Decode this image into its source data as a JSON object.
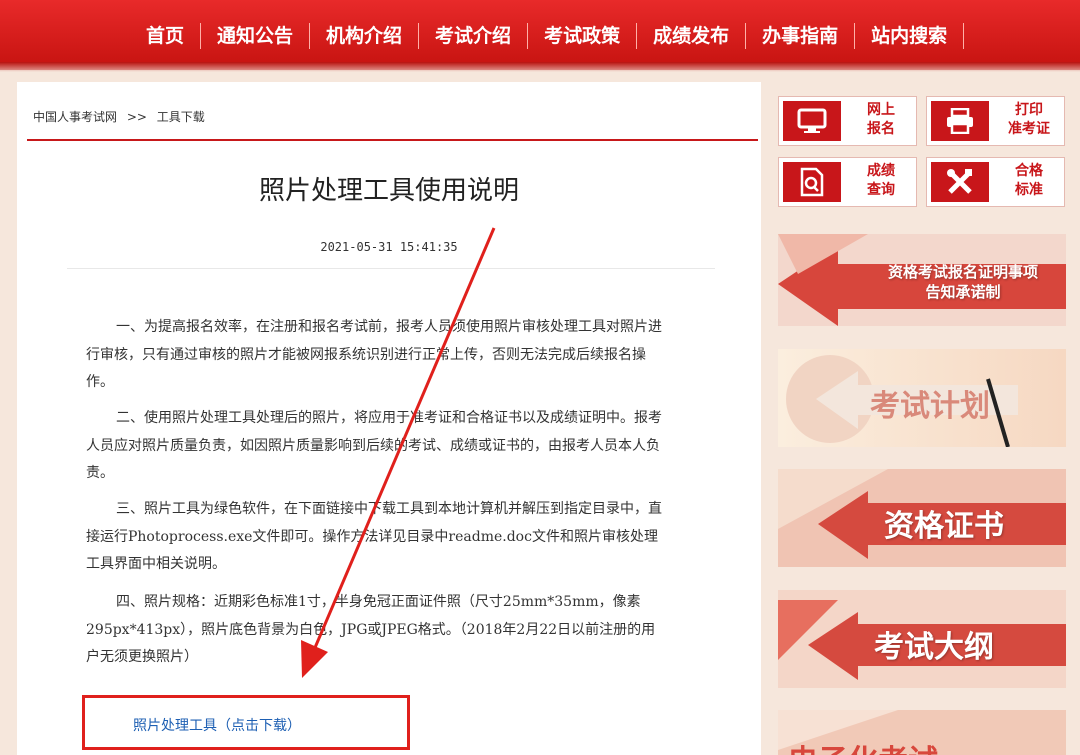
{
  "nav": {
    "items": [
      "首页",
      "通知公告",
      "机构介绍",
      "考试介绍",
      "考试政策",
      "成绩发布",
      "办事指南",
      "站内搜索"
    ]
  },
  "breadcrumb": {
    "home": "中国人事考试网",
    "sep": ">>",
    "current": "工具下载"
  },
  "article": {
    "title": "照片处理工具使用说明",
    "date": "2021-05-31 15:41:35",
    "paragraphs": [
      "一、为提高报名效率，在注册和报名考试前，报考人员须使用照片审核处理工具对照片进行审核，只有通过审核的照片才能被网报系统识别进行正常上传，否则无法完成后续报名操作。",
      "二、使用照片处理工具处理后的照片，将应用于准考证和合格证书以及成绩证明中。报考人员应对照片质量负责，如因照片质量影响到后续的考试、成绩或证书的，由报考人员本人负责。",
      "三、照片工具为绿色软件，在下面链接中下载工具到本地计算机并解压到指定目录中，直接运行Photoprocess.exe文件即可。操作方法详见目录中readme.doc文件和照片审核处理工具界面中相关说明。",
      "四、照片规格：近期彩色标准1寸，半身免冠正面证件照（尺寸25mm*35mm，像素295px*413px），照片底色背景为白色，JPG或JPEG格式。（2018年2月22日以前注册的用户无须更换照片）"
    ],
    "download_link": "照片处理工具（点击下载）"
  },
  "sidebar": {
    "quick": [
      {
        "line1": "网上",
        "line2": "报名",
        "icon": "monitor-icon"
      },
      {
        "line1": "打印",
        "line2": "准考证",
        "icon": "printer-icon"
      },
      {
        "line1": "成绩",
        "line2": "查询",
        "icon": "document-search-icon"
      },
      {
        "line1": "合格",
        "line2": "标准",
        "icon": "tools-icon"
      }
    ],
    "banners": [
      {
        "line1": "资格考试报名证明事项",
        "line2": "告知承诺制"
      },
      {
        "text": "考试计划"
      },
      {
        "text": "资格证书"
      },
      {
        "text": "考试大纲"
      },
      {
        "text": "电子化考试"
      }
    ]
  },
  "colors": {
    "brand_red": "#c8161a",
    "highlight_box": "#e0201c",
    "link_blue": "#1d5fb3"
  }
}
